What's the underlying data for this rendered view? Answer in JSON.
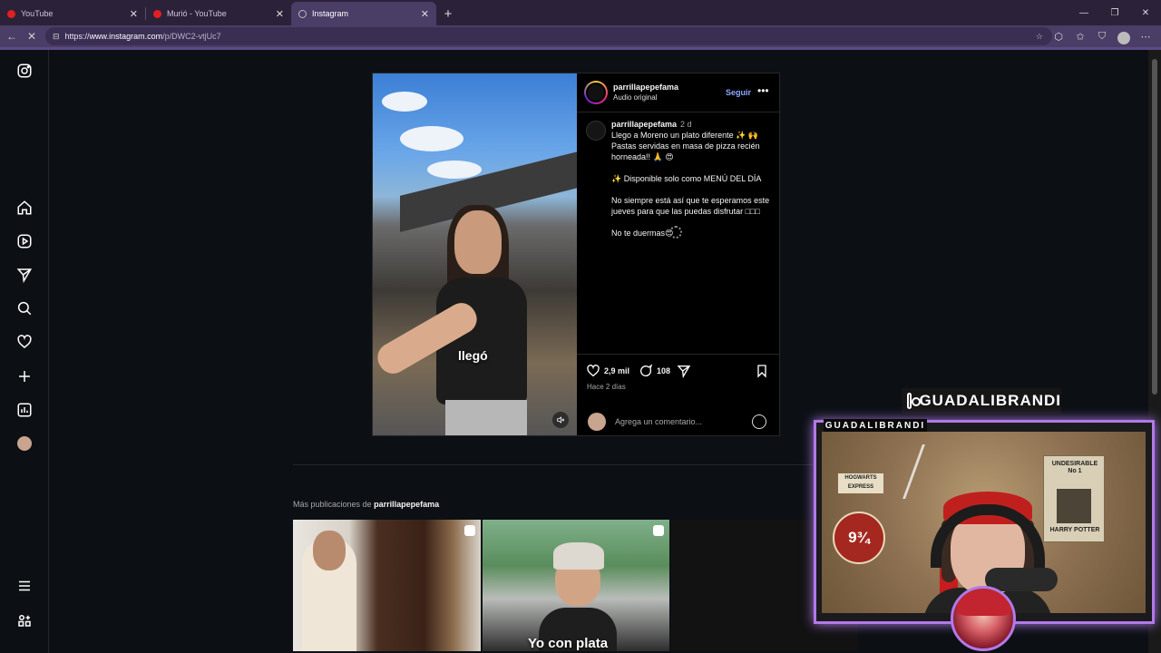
{
  "browser": {
    "tabs": [
      {
        "label": "YouTube",
        "color": "#e02020",
        "active": false
      },
      {
        "label": "Murió - YouTube",
        "color": "#e02020",
        "active": false
      },
      {
        "label": "Instagram",
        "color": "#a8a8a8",
        "active": true
      }
    ],
    "url_scheme": "https://",
    "url_host": "www.instagram.com",
    "url_path": "/p/DWC2-vtjUc7",
    "new_tab_symbol": "+"
  },
  "sidebar": {
    "icons": [
      "instagram-icon",
      "home-icon",
      "reels-icon",
      "messages-icon",
      "search-icon",
      "notifications-icon",
      "create-icon",
      "dashboard-icon",
      "profile-avatar",
      "menu-icon",
      "more-apps-icon"
    ]
  },
  "post": {
    "username": "parrillapepefama",
    "audio": "Audio original",
    "follow_label": "Seguir",
    "more_label": "•••",
    "video_caption": "llegó",
    "comment": {
      "username": "parrillapepefama",
      "time": "2 d",
      "lines": [
        "Llego a Moreno un plato diferente ✨ 🙌",
        "Pastas servidas en masa de pizza recién horneada!! 🙏 😍",
        "",
        "✨ Disponible solo como MENÚ DEL DÍA",
        "",
        "No siempre está así que te esperamos este jueves para que las puedas disfrutar □□□",
        "",
        "No te duermas😍"
      ]
    },
    "likes": "2,9 mil",
    "comments_count": "108",
    "posted": "Hace 2 días",
    "add_comment_placeholder": "Agrega un comentario..."
  },
  "more_pubs": {
    "prefix": "Más publicaciones de",
    "user": "parrillapepefama",
    "thumb2_caption": "Yo con plata"
  },
  "overlay": {
    "ig_handle": "GUADALIBRANDI",
    "cam_tag": "GUADALIBRANDI",
    "poster_title": "UNDESIRABLE\nNo 1",
    "poster_name": "HARRY POTTER",
    "hogwarts": "HOGWARTS\nEXPRESS",
    "platform": "9¾",
    "accent_color": "#b07ae8"
  }
}
